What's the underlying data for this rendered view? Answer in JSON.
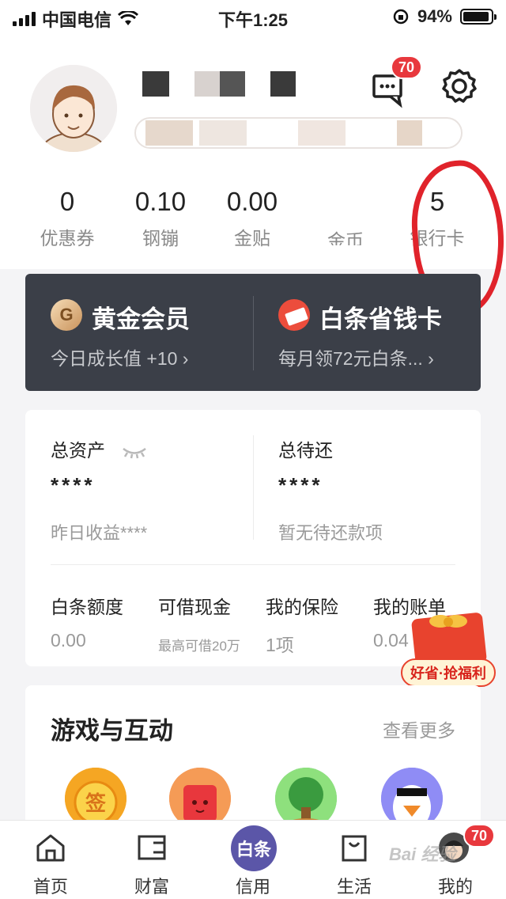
{
  "status": {
    "carrier": "中国电信",
    "time": "下午1:25",
    "battery": "94%",
    "battery_level": 0.94
  },
  "header": {
    "message_badge": "70"
  },
  "stats": [
    {
      "value": "0",
      "label": "优惠券"
    },
    {
      "value": "0.10",
      "label": "钢镚"
    },
    {
      "value": "0.00",
      "label": "金贴"
    },
    {
      "value": "",
      "label": "金币"
    },
    {
      "value": "5",
      "label": "银行卡"
    }
  ],
  "member": {
    "gold_title": "黄金会员",
    "gold_icon": "G",
    "gold_sub": "今日成长值 +10",
    "baitiao_title": "白条省钱卡",
    "baitiao_sub": "每月领72元白条..."
  },
  "assets": {
    "total_title": "总资产",
    "total_mask": "****",
    "total_sub": "昨日收益****",
    "repay_title": "总待还",
    "repay_mask": "****",
    "repay_sub": "暂无待还款项",
    "items": [
      {
        "label": "白条额度",
        "value": "0.00"
      },
      {
        "label": "可借现金",
        "value": "最高可借20万"
      },
      {
        "label": "我的保险",
        "value": "1项"
      },
      {
        "label": "我的账单",
        "value": "0.04"
      }
    ]
  },
  "promo": {
    "label": "好省·抢福利"
  },
  "games": {
    "title": "游戏与互动",
    "more": "查看更多",
    "sign_icon_text": "签"
  },
  "tabs": [
    {
      "label": "首页"
    },
    {
      "label": "财富"
    },
    {
      "label": "信用",
      "icon_text": "白条"
    },
    {
      "label": "生活"
    },
    {
      "label": "我的",
      "badge": "70"
    }
  ],
  "watermark": "Bai 经验"
}
